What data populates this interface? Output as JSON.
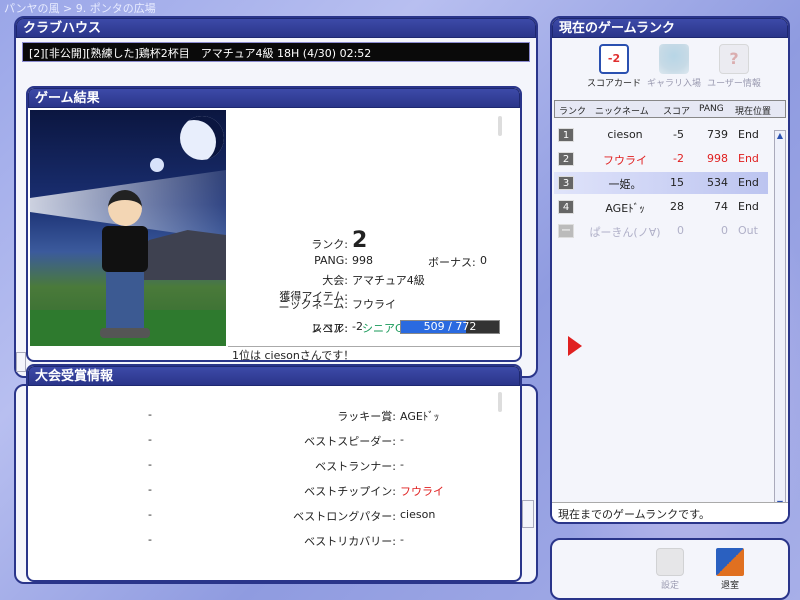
{
  "breadcrumb": "パンヤの風 > 9. ポンタの広場",
  "clubhouse": {
    "title": "クラブハウス",
    "room_info": "[2][非公開][熟練した]鶏杯2杯目　アマチュア4級 18H (4/30) 02:52"
  },
  "game_result": {
    "title": "ゲーム結果",
    "rank_label": "ランク:",
    "rank_value": "2",
    "tournament_label": "大会:",
    "tournament_value": "アマチュア4級",
    "nickname_label": "ニックネーム:",
    "nickname_value": "フウライ",
    "score_label": "スコア:",
    "score_value": "-2",
    "pang_label": "PANG:",
    "pang_value": "998",
    "bonus_label": "ボーナス:",
    "bonus_value": "0",
    "item_label": "獲得アイテム:",
    "level_label": "レベル:",
    "level_grade": "シニアC",
    "level_text": "509 / 772",
    "level_current": 509,
    "level_max": 772,
    "footer": "1位は ciesonさんです！"
  },
  "awards": {
    "title": "大会受賞情報",
    "rows": [
      {
        "left": "-",
        "label": "ラッキー賞:",
        "value": "AGEﾄﾞｯ",
        "highlight": false
      },
      {
        "left": "-",
        "label": "ベストスピーダー:",
        "value": "-",
        "highlight": false
      },
      {
        "left": "-",
        "label": "ベストランナー:",
        "value": "-",
        "highlight": false
      },
      {
        "left": "-",
        "label": "ベストチップイン:",
        "value": "フウライ",
        "highlight": true
      },
      {
        "left": "-",
        "label": "ベストロングパター:",
        "value": "cieson",
        "highlight": false
      },
      {
        "left": "-",
        "label": "ベストリカバリー:",
        "value": "-",
        "highlight": false
      }
    ]
  },
  "rank_panel": {
    "title": "現在のゲームランク",
    "tools": {
      "scorecard": "スコアカード",
      "scorecard_icon_text": "-2",
      "gallery": "ギャラリ入場",
      "userinfo": "ユーザー情報",
      "userinfo_icon_text": "?"
    },
    "headers": {
      "rank": "ランク",
      "nickname": "ニックネーム",
      "score": "スコア",
      "pang": "PANG",
      "position": "現在位置"
    },
    "rows": [
      {
        "rank": "1",
        "nickname": "cieson",
        "score": "-5",
        "pang": "739",
        "position": "End",
        "state": "normal"
      },
      {
        "rank": "2",
        "nickname": "フウライ",
        "score": "-2",
        "pang": "998",
        "position": "End",
        "state": "self"
      },
      {
        "rank": "3",
        "nickname": "一姫。",
        "score": "15",
        "pang": "534",
        "position": "End",
        "state": "selected"
      },
      {
        "rank": "4",
        "nickname": "AGEﾄﾞｯ",
        "score": "28",
        "pang": "74",
        "position": "End",
        "state": "normal"
      },
      {
        "rank": "ー",
        "nickname": "ぱーきん(ノ∀)",
        "score": "0",
        "pang": "0",
        "position": "Out",
        "state": "out"
      }
    ],
    "footer": "現在までのゲームランクです。"
  },
  "bottom": {
    "settings": "設定",
    "exit": "退室"
  },
  "colors": {
    "panel_border": "#2a358a",
    "highlight_red": "#e02020",
    "level_fill": "#2a6ae0",
    "grade_green": "#1a9a5a"
  }
}
